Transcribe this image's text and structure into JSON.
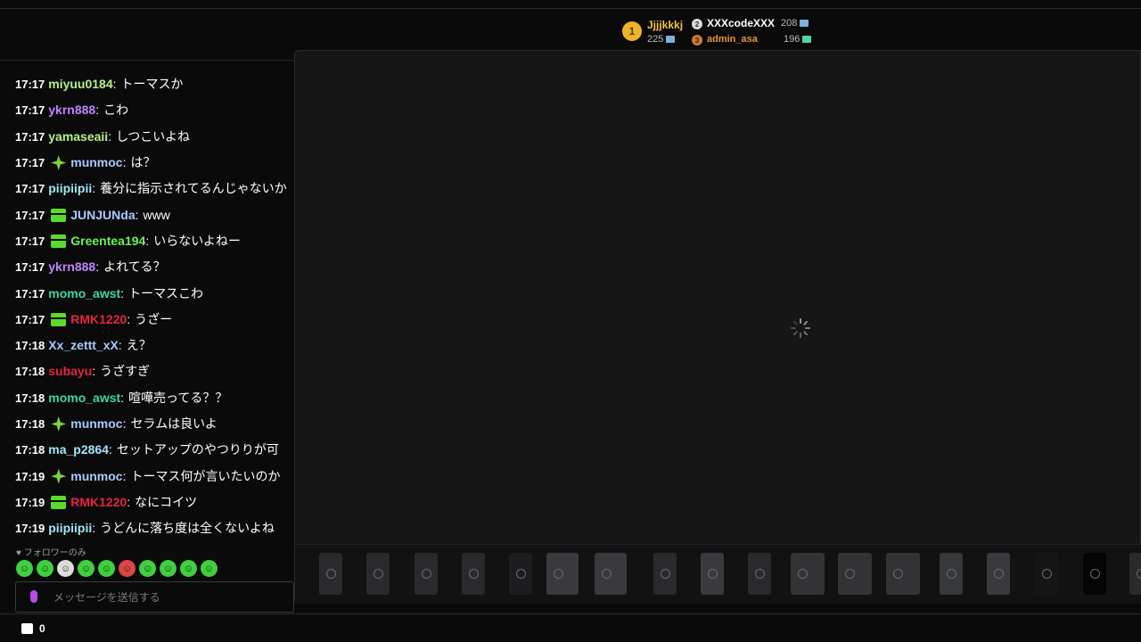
{
  "leaderboard": {
    "first": {
      "rank": "1",
      "name": "Jjjjkkkj",
      "score": "225"
    },
    "second": {
      "rank": "2",
      "name": "XXXcodeXXX",
      "score": "208"
    },
    "third": {
      "rank": "3",
      "name": "admin_asa",
      "score": "196"
    }
  },
  "chat": {
    "messages": [
      {
        "time": "17:17",
        "user": "miyuu0184",
        "color": "#b6f08a",
        "badge": "",
        "text": "トーマスか"
      },
      {
        "time": "17:17",
        "user": "ykrn888",
        "color": "#c084fc",
        "badge": "",
        "text": "こわ"
      },
      {
        "time": "17:17",
        "user": "yamaseaii",
        "color": "#b6f08a",
        "badge": "",
        "text": "しつこいよね"
      },
      {
        "time": "17:17",
        "user": "munmoc",
        "color": "#a9c9ff",
        "badge": "star",
        "text": "は？"
      },
      {
        "time": "17:17",
        "user": "piipiipii",
        "color": "#9fe7f5",
        "badge": "",
        "text": "養分に指示されてるんじゃないか"
      },
      {
        "time": "17:17",
        "user": "JUNJUNda",
        "color": "#a9c9ff",
        "badge": "gift",
        "text": "www"
      },
      {
        "time": "17:17",
        "user": "Greentea194",
        "color": "#6ef05a",
        "badge": "gift",
        "text": "いらないよねー"
      },
      {
        "time": "17:17",
        "user": "ykrn888",
        "color": "#c084fc",
        "badge": "",
        "text": "よれてる？"
      },
      {
        "time": "17:17",
        "user": "momo_awst",
        "color": "#3fd7a0",
        "badge": "",
        "text": "トーマスこわ"
      },
      {
        "time": "17:17",
        "user": "RMK1220",
        "color": "#e5243f",
        "badge": "gift",
        "text": "うざー"
      },
      {
        "time": "17:18",
        "user": "Xx_zettt_xX",
        "color": "#a9c9ff",
        "badge": "",
        "text": "え？"
      },
      {
        "time": "17:18",
        "user": "subayu",
        "color": "#e5243f",
        "badge": "",
        "text": "うざすぎ"
      },
      {
        "time": "17:18",
        "user": "momo_awst",
        "color": "#3fd7a0",
        "badge": "",
        "text": "喧嘩売ってる？？"
      },
      {
        "time": "17:18",
        "user": "munmoc",
        "color": "#a9c9ff",
        "badge": "star",
        "text": "セラムは良いよ"
      },
      {
        "time": "17:18",
        "user": "ma_p2864",
        "color": "#9fe7f5",
        "badge": "",
        "text": "セットアップのやつりりが可"
      },
      {
        "time": "17:19",
        "user": "munmoc",
        "color": "#a9c9ff",
        "badge": "star",
        "text": "トーマス何が言いたいのか"
      },
      {
        "time": "17:19",
        "user": "RMK1220",
        "color": "#e5243f",
        "badge": "gift",
        "text": "なにコイツ"
      },
      {
        "time": "17:19",
        "user": "piipiipii",
        "color": "#9fe7f5",
        "badge": "",
        "text": "うどんに落ち度は全くないよね"
      }
    ],
    "follower_only": "♥ フォロワーのみ",
    "input_placeholder": "メッセージを送信する"
  },
  "shop": {
    "count": "0"
  }
}
